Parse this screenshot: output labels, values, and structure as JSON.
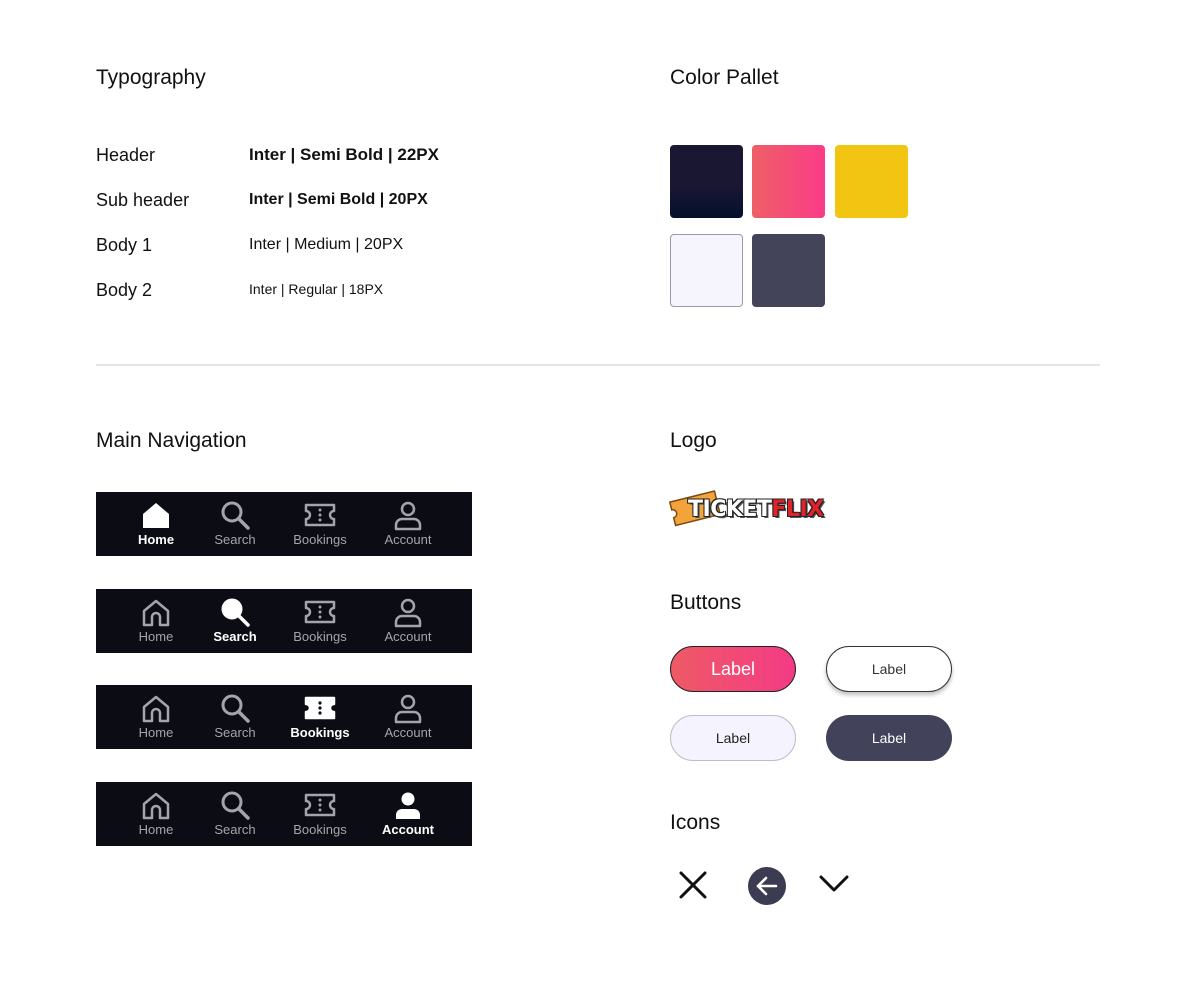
{
  "typography": {
    "title": "Typography",
    "rows": [
      {
        "name": "Header",
        "spec": "Inter | Semi Bold | 22PX"
      },
      {
        "name": "Sub header",
        "spec": "Inter | Semi Bold | 20PX"
      },
      {
        "name": "Body 1",
        "spec": "Inter | Medium | 20PX"
      },
      {
        "name": "Body 2",
        "spec": "Inter | Regular | 18PX"
      }
    ]
  },
  "palette": {
    "title": "Color Pallet",
    "colors": {
      "navy_top": "#1a1733",
      "navy_bottom": "#03102b",
      "gradient_start": "#ee5f66",
      "gradient_end": "#fb3b88",
      "yellow": "#f1c512",
      "lavender": "#f6f4fd",
      "slate": "#43445a"
    }
  },
  "navigation": {
    "title": "Main Navigation",
    "labels": [
      "Home",
      "Search",
      "Bookings",
      "Account"
    ],
    "bars": [
      {
        "active": "Home"
      },
      {
        "active": "Search"
      },
      {
        "active": "Bookings"
      },
      {
        "active": "Account"
      }
    ]
  },
  "logo": {
    "title": "Logo",
    "text_part1": "TICKET",
    "text_part2": "FLIX"
  },
  "buttons": {
    "title": "Buttons",
    "primary_label": "Label",
    "outline_label": "Label",
    "light_label": "Label",
    "dark_label": "Label"
  },
  "icons": {
    "title": "Icons",
    "list": [
      "close-icon",
      "arrow-left-circle-icon",
      "chevron-down-icon"
    ]
  }
}
